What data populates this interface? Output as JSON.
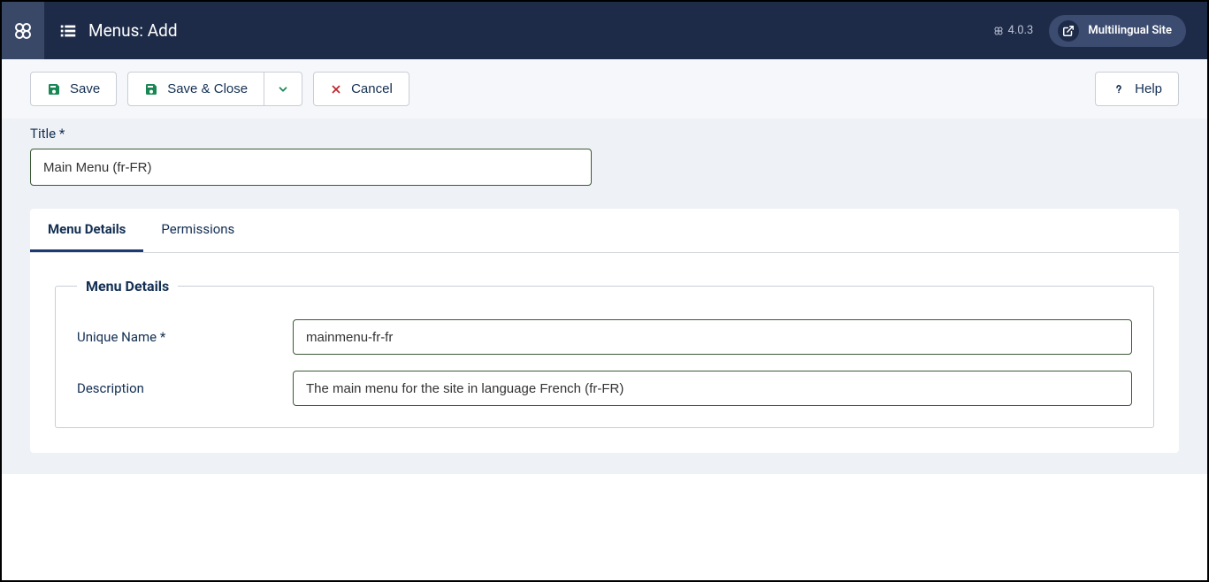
{
  "topbar": {
    "page_title": "Menus: Add",
    "version": "4.0.3",
    "site_button": "Multilingual Site"
  },
  "toolbar": {
    "save": "Save",
    "save_close": "Save & Close",
    "cancel": "Cancel",
    "help": "Help"
  },
  "form": {
    "title_label": "Title *",
    "title_value": "Main Menu (fr-FR)",
    "tabs": {
      "details": "Menu Details",
      "permissions": "Permissions"
    },
    "fieldset_legend": "Menu Details",
    "unique_name_label": "Unique Name *",
    "unique_name_value": "mainmenu-fr-fr",
    "description_label": "Description",
    "description_value": "The main menu for the site in language French (fr-FR)"
  }
}
